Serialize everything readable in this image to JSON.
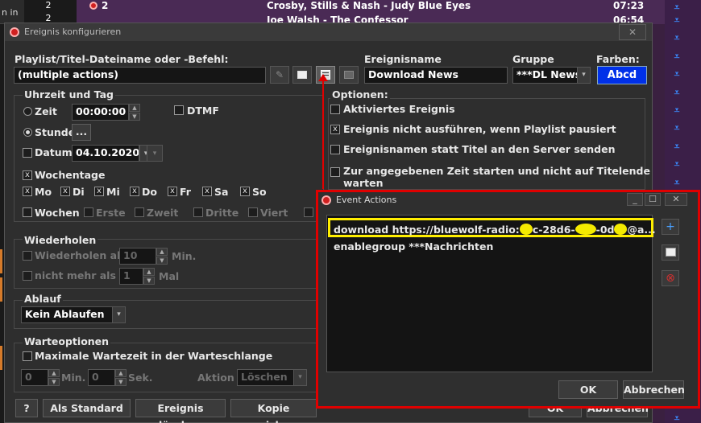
{
  "background": {
    "left_text": "n in",
    "rows": [
      {
        "num": "2",
        "title": "Crosby, Stills & Nash - Judy Blue Eyes",
        "time": "07:23"
      },
      {
        "num": "2",
        "title": "Joe Walsh - The Confessor",
        "time": "06:54"
      }
    ],
    "arrow_glyph": "⩡"
  },
  "dialog": {
    "title": "Ereignis konfigurieren",
    "close_glyph": "✕",
    "playlist_label": "Playlist/Titel-Dateiname oder -Befehl:",
    "playlist_value": "(multiple actions)",
    "eventname_label": "Ereignisname",
    "eventname_value": "Download News",
    "group_label": "Gruppe",
    "group_value": "***DL News",
    "colors_label": "Farben:",
    "colors_value": "Abcd",
    "color_accent": "#0030e8",
    "time_group_label": "Uhrzeit und Tag",
    "zeit_label": "Zeit",
    "zeit_value": "00:00:00",
    "dtmf_label": "DTMF",
    "stunde_label": "Stunde",
    "stunde_button": "...",
    "datum_label": "Datum",
    "datum_value": "04.10.2020",
    "wochentage_label": "Wochentage",
    "days": [
      "Mo",
      "Di",
      "Mi",
      "Do",
      "Fr",
      "Sa",
      "So"
    ],
    "weeks_label": "Wochen",
    "weeks": [
      "Erste",
      "Zweit",
      "Dritte",
      "Viert"
    ],
    "options_label": "Optionen:",
    "options": [
      {
        "label": "Aktiviertes Ereignis",
        "checked": false
      },
      {
        "label": "Ereignis nicht ausführen, wenn Playlist pausiert",
        "checked": true
      },
      {
        "label": "Ereignisnamen statt Titel an den Server senden",
        "checked": false
      },
      {
        "label": "Zur angegebenen Zeit starten und nicht auf Titelende",
        "label2": "warten",
        "checked": false
      }
    ],
    "repeat_label": "Wiederholen",
    "repeat_every_label": "Wiederholen alle",
    "repeat_every_value": "10",
    "repeat_every_unit": "Min.",
    "repeat_max_label": "nicht mehr als",
    "repeat_max_value": "1",
    "repeat_max_unit": "Mal",
    "ablauf_label": "Ablauf",
    "ablauf_value": "Kein Ablaufen",
    "wait_label": "Warteoptionen",
    "wait_max_label": "Maximale Wartezeit in der Warteschlange",
    "wait_min_value": "0",
    "wait_min_unit": "Min.",
    "wait_sec_value": "0",
    "wait_sec_unit": "Sek.",
    "aktion_label": "Aktion",
    "aktion_value": "Löschen",
    "btn_help": "?",
    "btn_default": "Als Standard",
    "btn_delete": "Ereignis löschen",
    "btn_copy": "Kopie speichern",
    "btn_ok": "OK",
    "btn_cancel": "Abbrechen"
  },
  "event_actions": {
    "title": "Event Actions",
    "min_glyph": "_",
    "max_glyph": "☐",
    "close_glyph": "✕",
    "items": [
      "download https://bluewolf-radio:",
      "enablegroup ***Nachrichten"
    ],
    "item1_mid_a": "c-28d6-",
    "item1_mid_b": "-0d",
    "item1_tail": "@a...",
    "btn_ok": "OK",
    "btn_cancel": "Abbrechen",
    "add_glyph": "+",
    "remove_glyph": "⊗"
  }
}
